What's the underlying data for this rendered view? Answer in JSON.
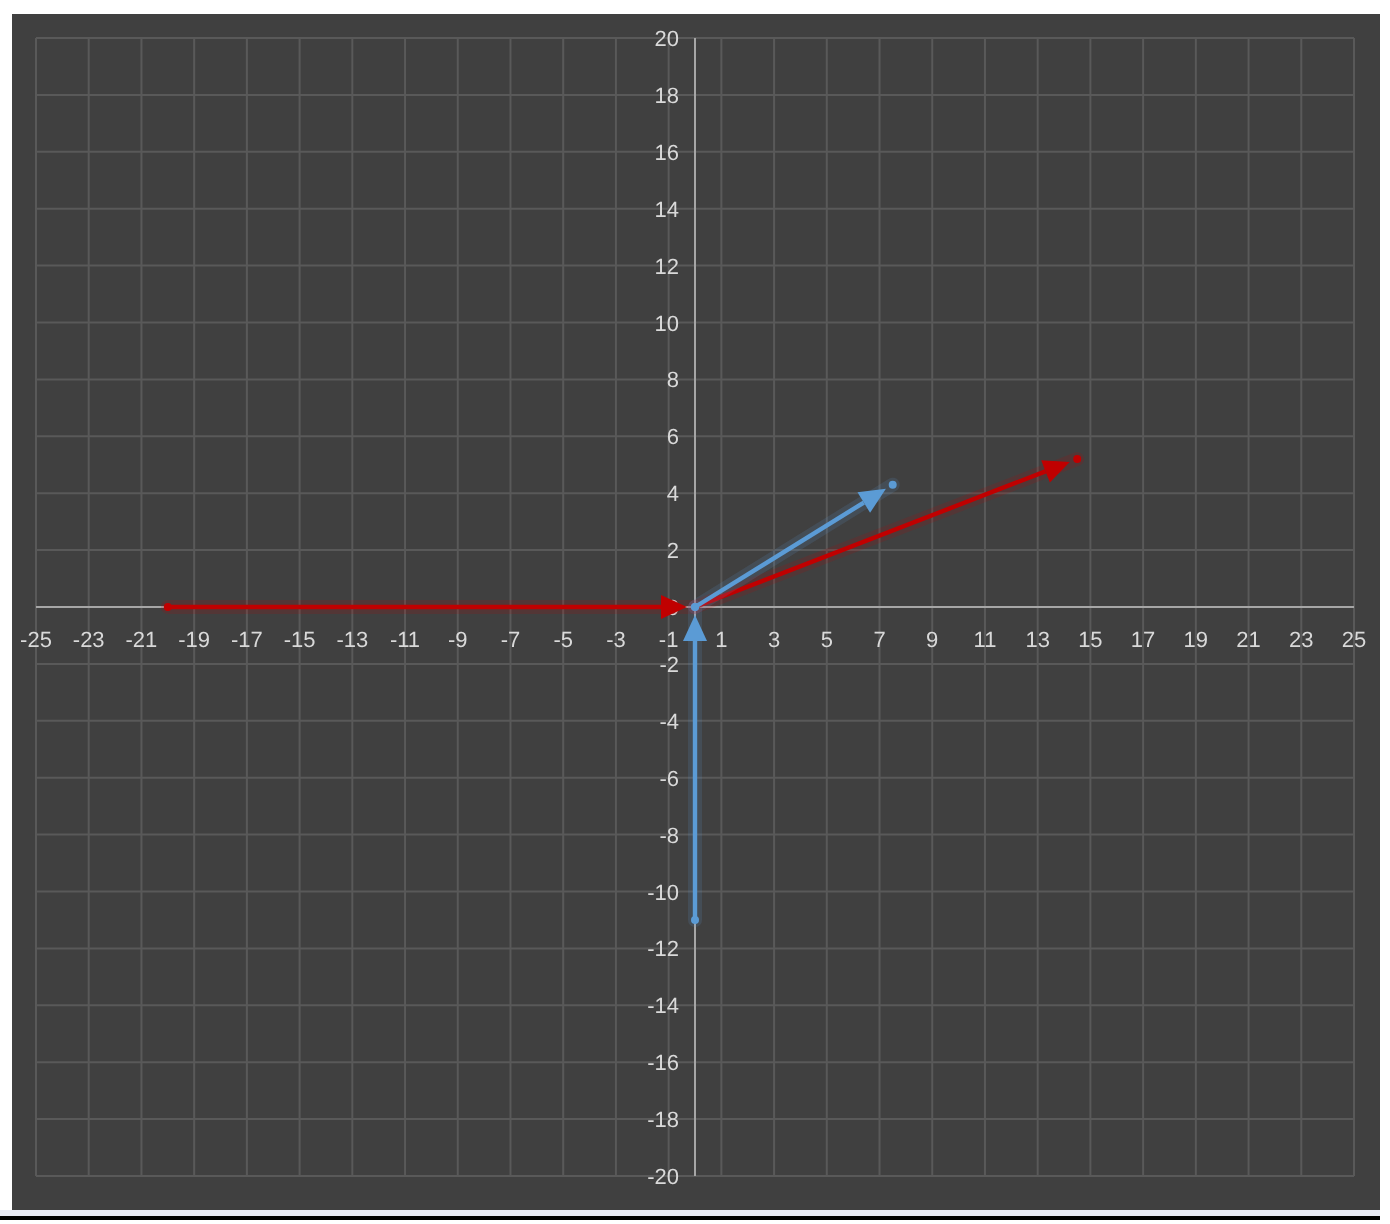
{
  "chart": {
    "chart_data": {
      "type": "scatter",
      "grid": true,
      "xlim": [
        -25,
        25
      ],
      "ylim": [
        -20,
        20
      ],
      "xticks": [
        -25,
        -23,
        -21,
        -19,
        -17,
        -15,
        -13,
        -11,
        -9,
        -7,
        -5,
        -3,
        -1,
        1,
        3,
        5,
        7,
        9,
        11,
        13,
        15,
        17,
        19,
        21,
        23,
        25
      ],
      "yticks": [
        -20,
        -18,
        -16,
        -14,
        -12,
        -10,
        -8,
        -6,
        -4,
        -2,
        0,
        2,
        4,
        6,
        8,
        10,
        12,
        14,
        16,
        18,
        20
      ],
      "series": [
        {
          "color": "#c00000",
          "x": [
            -20,
            0
          ],
          "values": [
            0,
            0
          ]
        },
        {
          "color": "#c00000",
          "x": [
            0,
            14.5
          ],
          "values": [
            0,
            5.2
          ]
        },
        {
          "color": "#5b9bd5",
          "x": [
            0,
            0
          ],
          "values": [
            -11,
            0
          ]
        },
        {
          "color": "#5b9bd5",
          "x": [
            0,
            7.5
          ],
          "values": [
            0,
            4.3
          ]
        }
      ]
    }
  }
}
